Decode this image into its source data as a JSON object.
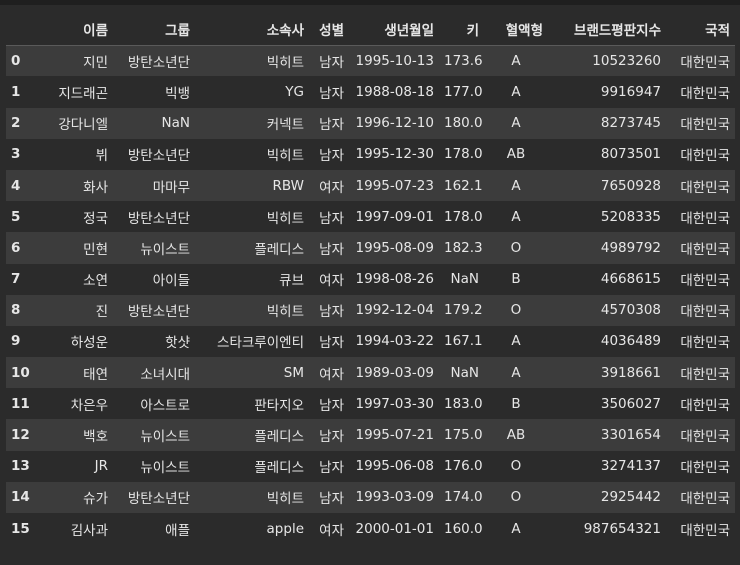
{
  "columns": [
    "",
    "이름",
    "그룹",
    "소속사",
    "성별",
    "생년월일",
    "키",
    "혈액형",
    "브랜드평판지수",
    "국적"
  ],
  "rows": [
    {
      "idx": "0",
      "name": "지민",
      "group": "방탄소년단",
      "agency": "빅히트",
      "gender": "남자",
      "birth": "1995-10-13",
      "height": "173.6",
      "blood": "A",
      "brand": "10523260",
      "nation": "대한민국"
    },
    {
      "idx": "1",
      "name": "지드래곤",
      "group": "빅뱅",
      "agency": "YG",
      "gender": "남자",
      "birth": "1988-08-18",
      "height": "177.0",
      "blood": "A",
      "brand": "9916947",
      "nation": "대한민국"
    },
    {
      "idx": "2",
      "name": "강다니엘",
      "group": "NaN",
      "agency": "커넥트",
      "gender": "남자",
      "birth": "1996-12-10",
      "height": "180.0",
      "blood": "A",
      "brand": "8273745",
      "nation": "대한민국"
    },
    {
      "idx": "3",
      "name": "뷔",
      "group": "방탄소년단",
      "agency": "빅히트",
      "gender": "남자",
      "birth": "1995-12-30",
      "height": "178.0",
      "blood": "AB",
      "brand": "8073501",
      "nation": "대한민국"
    },
    {
      "idx": "4",
      "name": "화사",
      "group": "마마무",
      "agency": "RBW",
      "gender": "여자",
      "birth": "1995-07-23",
      "height": "162.1",
      "blood": "A",
      "brand": "7650928",
      "nation": "대한민국"
    },
    {
      "idx": "5",
      "name": "정국",
      "group": "방탄소년단",
      "agency": "빅히트",
      "gender": "남자",
      "birth": "1997-09-01",
      "height": "178.0",
      "blood": "A",
      "brand": "5208335",
      "nation": "대한민국"
    },
    {
      "idx": "6",
      "name": "민현",
      "group": "뉴이스트",
      "agency": "플레디스",
      "gender": "남자",
      "birth": "1995-08-09",
      "height": "182.3",
      "blood": "O",
      "brand": "4989792",
      "nation": "대한민국"
    },
    {
      "idx": "7",
      "name": "소연",
      "group": "아이들",
      "agency": "큐브",
      "gender": "여자",
      "birth": "1998-08-26",
      "height": "NaN",
      "blood": "B",
      "brand": "4668615",
      "nation": "대한민국"
    },
    {
      "idx": "8",
      "name": "진",
      "group": "방탄소년단",
      "agency": "빅히트",
      "gender": "남자",
      "birth": "1992-12-04",
      "height": "179.2",
      "blood": "O",
      "brand": "4570308",
      "nation": "대한민국"
    },
    {
      "idx": "9",
      "name": "하성운",
      "group": "핫샷",
      "agency": "스타크루이엔티",
      "gender": "남자",
      "birth": "1994-03-22",
      "height": "167.1",
      "blood": "A",
      "brand": "4036489",
      "nation": "대한민국"
    },
    {
      "idx": "10",
      "name": "태연",
      "group": "소녀시대",
      "agency": "SM",
      "gender": "여자",
      "birth": "1989-03-09",
      "height": "NaN",
      "blood": "A",
      "brand": "3918661",
      "nation": "대한민국"
    },
    {
      "idx": "11",
      "name": "차은우",
      "group": "아스트로",
      "agency": "판타지오",
      "gender": "남자",
      "birth": "1997-03-30",
      "height": "183.0",
      "blood": "B",
      "brand": "3506027",
      "nation": "대한민국"
    },
    {
      "idx": "12",
      "name": "백호",
      "group": "뉴이스트",
      "agency": "플레디스",
      "gender": "남자",
      "birth": "1995-07-21",
      "height": "175.0",
      "blood": "AB",
      "brand": "3301654",
      "nation": "대한민국"
    },
    {
      "idx": "13",
      "name": "JR",
      "group": "뉴이스트",
      "agency": "플레디스",
      "gender": "남자",
      "birth": "1995-06-08",
      "height": "176.0",
      "blood": "O",
      "brand": "3274137",
      "nation": "대한민국"
    },
    {
      "idx": "14",
      "name": "슈가",
      "group": "방탄소년단",
      "agency": "빅히트",
      "gender": "남자",
      "birth": "1993-03-09",
      "height": "174.0",
      "blood": "O",
      "brand": "2925442",
      "nation": "대한민국"
    },
    {
      "idx": "15",
      "name": "김사과",
      "group": "애플",
      "agency": "apple",
      "gender": "여자",
      "birth": "2000-01-01",
      "height": "160.0",
      "blood": "A",
      "brand": "987654321",
      "nation": "대한민국"
    }
  ]
}
